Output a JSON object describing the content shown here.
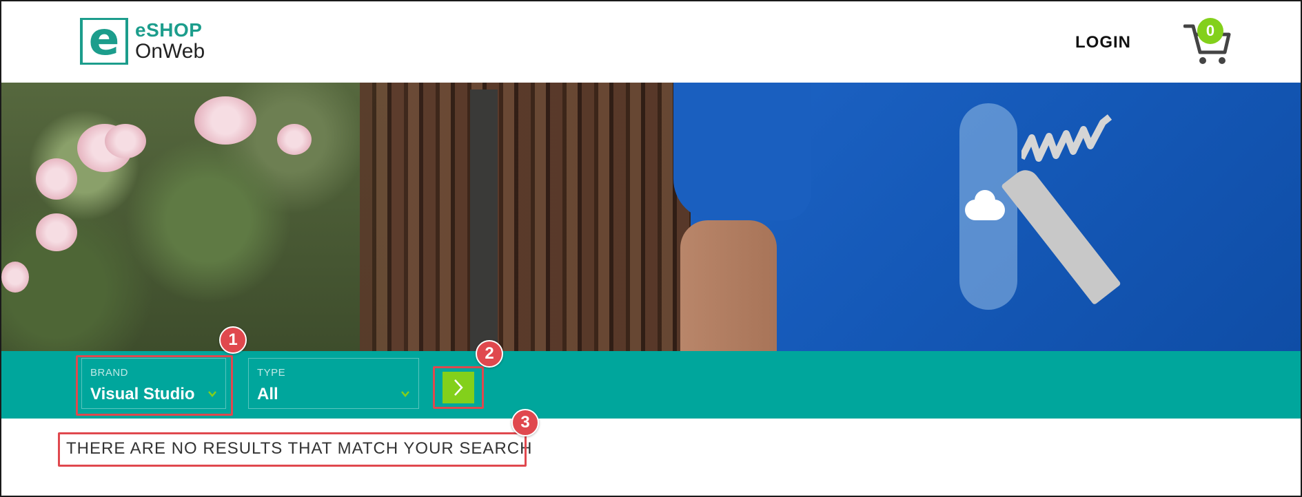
{
  "header": {
    "logo_line1": "eSHOP",
    "logo_line2": "OnWeb",
    "logo_letter": "e",
    "login_label": "LOGIN",
    "cart_count": "0"
  },
  "filters": {
    "brand": {
      "label": "BRAND",
      "value": "Visual Studio"
    },
    "type": {
      "label": "TYPE",
      "value": "All"
    },
    "apply_icon": "chevron-right-icon"
  },
  "results": {
    "message": "THERE ARE NO RESULTS THAT MATCH YOUR SEARCH"
  },
  "annotations": [
    "1",
    "2",
    "3"
  ],
  "colors": {
    "brand_teal": "#00a69c",
    "accent_green": "#83d01b",
    "annotation_red": "#e0484e"
  }
}
